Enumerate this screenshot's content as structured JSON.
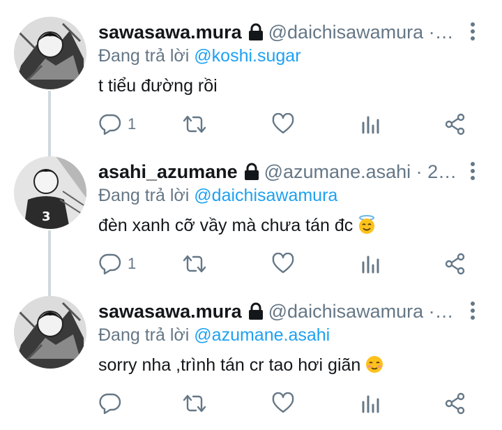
{
  "tweets": [
    {
      "name": "sawasawa.mura",
      "handle": "@daichisawamura ·…",
      "replying_prefix": "Đang trả lời",
      "replying_to": "@koshi.sugar",
      "text": "t tiểu đường rồi",
      "emoji": "",
      "reply_count": "1",
      "avatar_icon": "manga-avatar-icon"
    },
    {
      "name": "asahi_azumane",
      "handle": "@azumane.asahi · 2…",
      "replying_prefix": "Đang trả lời",
      "replying_to": "@daichisawamura",
      "text": "đèn xanh cỡ vầy mà chưa tán đc",
      "emoji": "halo-smile-emoji",
      "reply_count": "1",
      "avatar_icon": "manga-avatar-icon"
    },
    {
      "name": "sawasawa.mura",
      "handle": "@daichisawamura ·…",
      "replying_prefix": "Đang trả lời",
      "replying_to": "@azumane.asahi",
      "text": "sorry nha ,trình tán cr tao hơi giãn",
      "emoji": "blush-smile-emoji",
      "reply_count": "",
      "avatar_icon": "manga-avatar-icon"
    }
  ],
  "colors": {
    "accent": "#1da1f2",
    "secondary": "#657786",
    "text": "#14171a",
    "thread_line": "#cfd9de"
  }
}
